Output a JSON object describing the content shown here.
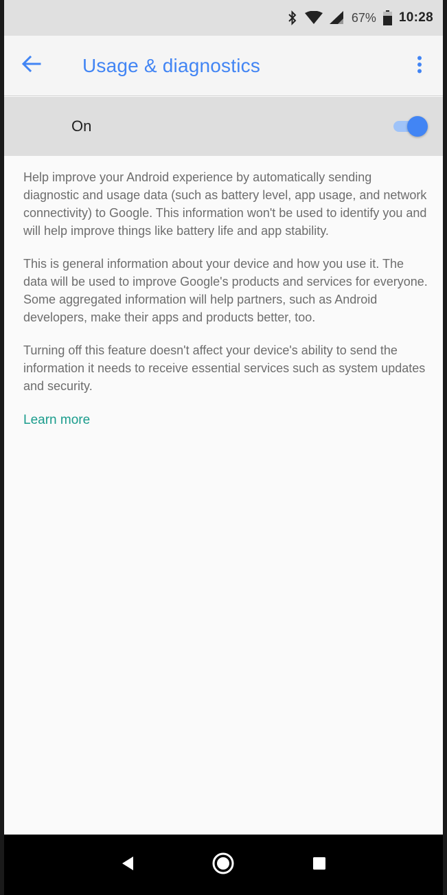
{
  "status_bar": {
    "battery_percent": "67%",
    "time": "10:28",
    "icons": [
      "bluetooth-icon",
      "wifi-icon",
      "signal-icon",
      "battery-icon"
    ]
  },
  "app_bar": {
    "title": "Usage & diagnostics",
    "back_icon": "arrow-back-icon",
    "overflow_icon": "more-vert-icon"
  },
  "master_switch": {
    "label": "On",
    "checked": true
  },
  "content": {
    "paragraphs": [
      "Help improve your Android experience by automatically sending diagnostic and usage data (such as battery level, app usage, and network connectivity) to Google. This information won't be used to identify you and will help improve things like battery life and app stability.",
      "This is general information about your device and how you use it. The data will be used to improve Google's products and services for everyone. Some aggregated information will help partners, such as Android developers, make their apps and products better, too.",
      "Turning off this feature doesn't affect your device's ability to send the information it needs to receive essential services such as system updates and security."
    ],
    "learn_more": "Learn more"
  },
  "colors": {
    "accent": "#4285f4",
    "link": "#1a9c8c"
  },
  "nav_bar": {
    "icons": [
      "back-triangle-icon",
      "home-circle-icon",
      "recents-square-icon"
    ]
  }
}
